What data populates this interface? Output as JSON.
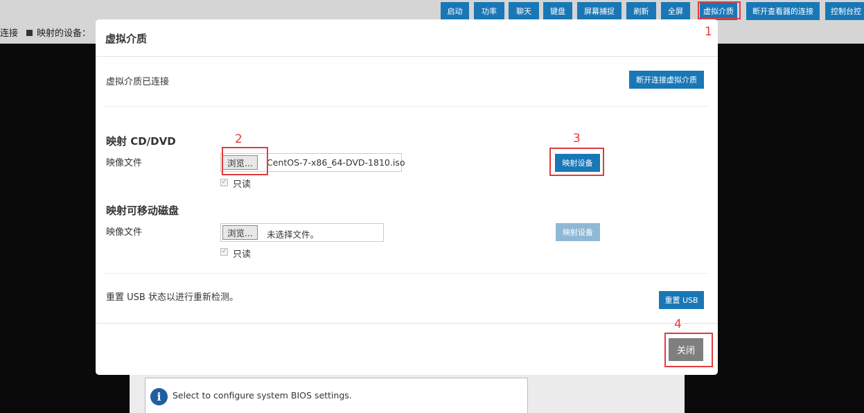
{
  "toolbar": {
    "items": [
      "启动",
      "功率",
      "聊天",
      "键盘",
      "屏幕捕捉",
      "刷新",
      "全屏",
      "虚拟介质",
      "断开查看器的连接",
      "控制台控"
    ]
  },
  "status_bar": {
    "connection_label": "连接",
    "mapped_devices_label": "映射的设备："
  },
  "bios_hint": {
    "icon": "info-icon",
    "text": "Select to configure system BIOS settings."
  },
  "modal": {
    "title": "虚拟介质",
    "connected_status": "虚拟介质已连接",
    "disconnect_label": "断开连接虚拟介质",
    "cd_dvd": {
      "heading": "映射 CD/DVD",
      "image_file_label": "映像文件",
      "browse_label": "浏览...",
      "file_name": "CentOS-7-x86_64-DVD-1810.iso",
      "readonly_label": "只读",
      "readonly_checked": true,
      "map_label": "映射设备"
    },
    "removable": {
      "heading": "映射可移动磁盘",
      "image_file_label": "映像文件",
      "browse_label": "浏览...",
      "file_name": "未选择文件。",
      "readonly_label": "只读",
      "readonly_checked": true,
      "map_label": "映射设备"
    },
    "usb_reset_text": "重置 USB 状态以进行重新检测。",
    "usb_reset_label": "重置 USB",
    "close_label": "关闭"
  },
  "annotations": {
    "labels": [
      "1",
      "2",
      "3",
      "4"
    ],
    "color": "#e23a3a"
  },
  "colors": {
    "primary_button": "#1a77b6",
    "disabled_button": "#8fb8d6",
    "close_button": "#7f7f7f"
  }
}
